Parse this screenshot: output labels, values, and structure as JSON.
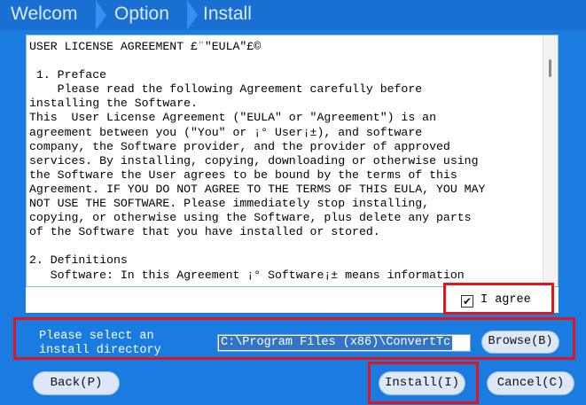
{
  "steps": [
    "Welcom",
    "Option",
    "Install"
  ],
  "license": {
    "lines": [
      "USER LICENSE AGREEMENT £¨\"EULA\"£©",
      "",
      " 1. Preface",
      "    Please read the following Agreement carefully before",
      "installing the Software.",
      "This  User License Agreement (\"EULA\" or \"Agreement\") is an",
      "agreement between you (\"You\" or ¡° User¡±), and software",
      "company, the Software provider, and the provider of approved",
      "services. By installing, copying, downloading or otherwise using",
      "the Software the User agrees to be bound by the terms of this",
      "Agreement. IF YOU DO NOT AGREE TO THE TERMS OF THIS EULA, YOU MAY",
      "NOT USE THE SOFTWARE. Please immediately stop installing,",
      "copying, or otherwise using the Software, plus delete any parts",
      "of the Software that you have installed or stored.",
      "",
      "2. Definitions",
      "   Software: In this Agreement ¡° Software¡± means information"
    ]
  },
  "agree": {
    "checked_mark": "✔",
    "label": "I agree"
  },
  "install_dir": {
    "label": "Please select an\ninstall directory",
    "value": "C:\\Program Files (x86)\\ConvertTc",
    "browse_label": "Browse(B)"
  },
  "buttons": {
    "back": "Back(P)",
    "install": "Install(I)",
    "cancel": "Cancel(C)"
  },
  "colors": {
    "background": "#1a7be0",
    "highlight": "#e0161b"
  }
}
